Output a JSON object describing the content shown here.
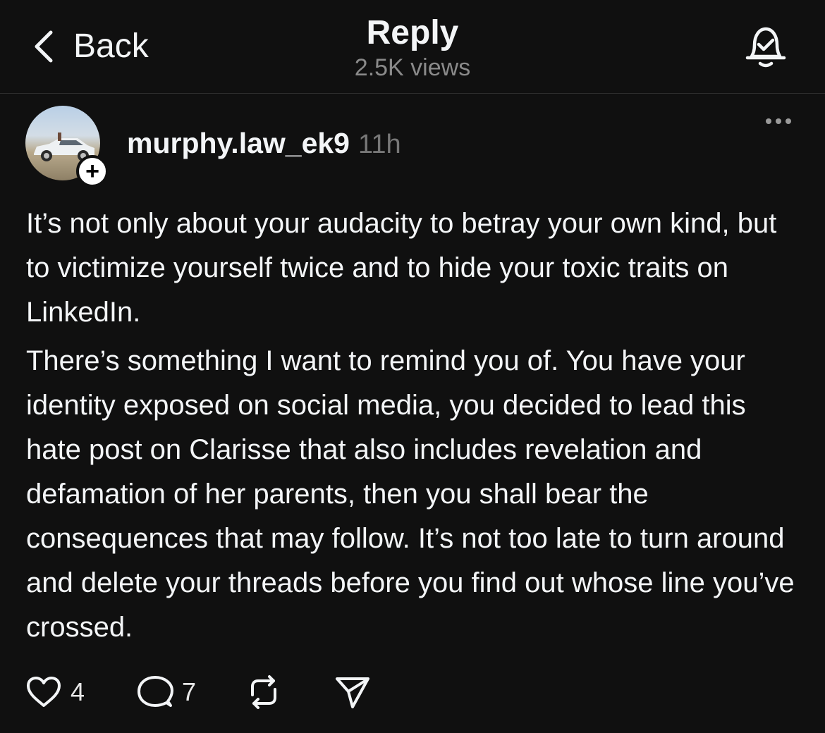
{
  "header": {
    "back_label": "Back",
    "title": "Reply",
    "views": "2.5K views"
  },
  "post": {
    "username": "murphy.law_ek9",
    "time": "11h",
    "follow_symbol": "+",
    "paragraphs": [
      "It’s not only about your audacity to betray your own kind, but to victimize yourself twice and to hide your toxic traits on LinkedIn.",
      "There’s something I want to remind you of. You have your identity exposed on social media, you decided to lead this hate post on Clarisse that also includes revelation and defamation of her parents, then you shall bear the consequences that may follow. It’s not too late to turn around and delete your threads before you find out whose line you’ve crossed."
    ]
  },
  "actions": {
    "likes": "4",
    "replies": "7"
  },
  "icons": {
    "back": "chevron-left-icon",
    "notification": "bell-check-icon",
    "more": "more-horizontal-icon",
    "like": "heart-icon",
    "reply": "comment-icon",
    "repost": "repost-icon",
    "share": "send-icon"
  },
  "colors": {
    "background": "#101010",
    "text": "#f3f5f7",
    "secondary_text": "#8a8a8a",
    "divider": "#2e2e2e"
  }
}
